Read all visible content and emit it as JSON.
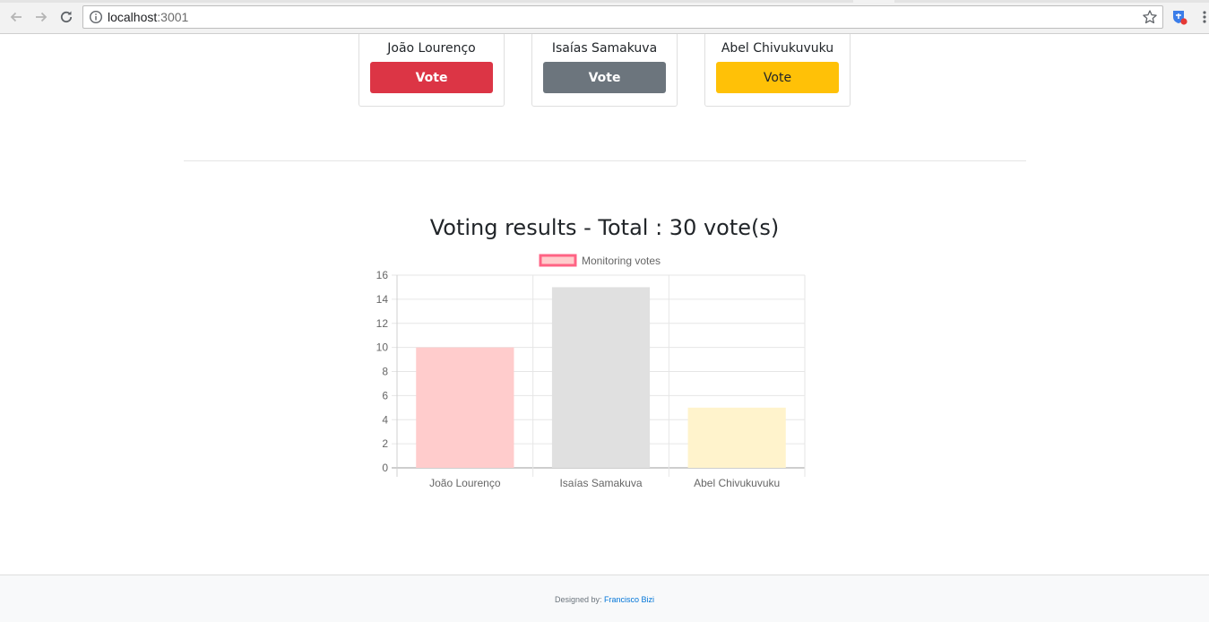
{
  "browser": {
    "url_host": "localhost",
    "url_port": ":3001"
  },
  "candidates": [
    {
      "name": "João Lourenço",
      "button_label": "Vote",
      "color": "#dc3545"
    },
    {
      "name": "Isaías Samakuva",
      "button_label": "Vote",
      "color": "#6c757d"
    },
    {
      "name": "Abel Chivukuvuku",
      "button_label": "Vote",
      "color": "#ffc107"
    }
  ],
  "results": {
    "title": "Voting results - Total : 30 vote(s)"
  },
  "chart_data": {
    "type": "bar",
    "categories": [
      "João Lourenço",
      "Isaías Samakuva",
      "Abel Chivukuvuku"
    ],
    "series": [
      {
        "name": "Monitoring votes",
        "values": [
          10,
          15,
          5
        ],
        "colors": [
          "#ffcccc",
          "#e0e0e0",
          "#fff3cc"
        ]
      }
    ],
    "legend_color": "#ff6384",
    "legend_fill": "#ffcccc",
    "ylim": [
      0,
      16
    ],
    "yticks": [
      0,
      2,
      4,
      6,
      8,
      10,
      12,
      14,
      16
    ],
    "grid": true,
    "legend": "top"
  },
  "footer": {
    "prefix": "Designed by:",
    "author": "Francisco Bizi"
  }
}
